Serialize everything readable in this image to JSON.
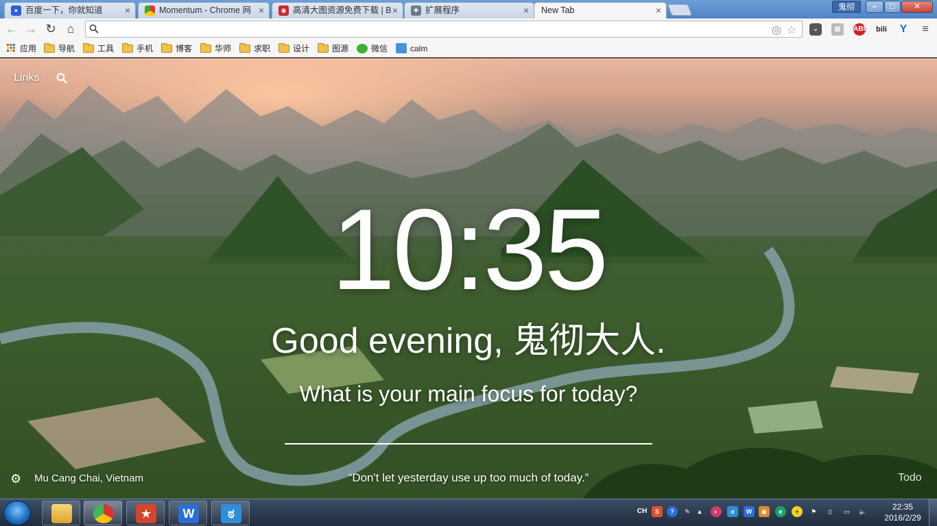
{
  "tabs": [
    {
      "title": "百度一下，你就知道",
      "favicon": "baidu-paw-icon",
      "active": false
    },
    {
      "title": "Momentum - Chrome 网",
      "favicon": "chrome-webstore-icon",
      "active": false
    },
    {
      "title": "高清大图资源免费下载 | B",
      "favicon": "image-site-icon",
      "active": false
    },
    {
      "title": "扩展程序",
      "favicon": "puzzle-piece-icon",
      "active": false
    },
    {
      "title": "New Tab",
      "favicon": "",
      "active": true
    }
  ],
  "window": {
    "user_name": "鬼彻",
    "minimize": "–",
    "maximize": "□",
    "close": "✕"
  },
  "toolbar": {
    "address_value": "",
    "extensions": [
      "pocket-icon",
      "tabs-manager-icon",
      "adblock-plus-icon",
      "bilibili-icon",
      "vpn-icon"
    ],
    "abp_label": "ABP",
    "bili_label": "bili",
    "menu_icon": "hamburger-menu-icon"
  },
  "bookmarks": [
    {
      "label": "应用",
      "type": "apps"
    },
    {
      "label": "导航",
      "type": "folder"
    },
    {
      "label": "工具",
      "type": "folder"
    },
    {
      "label": "手机",
      "type": "folder"
    },
    {
      "label": "博客",
      "type": "folder"
    },
    {
      "label": "华师",
      "type": "folder"
    },
    {
      "label": "求职",
      "type": "folder"
    },
    {
      "label": "设计",
      "type": "folder"
    },
    {
      "label": "图源",
      "type": "folder"
    },
    {
      "label": "微信",
      "type": "wechat"
    },
    {
      "label": "calm",
      "type": "calm"
    }
  ],
  "momentum": {
    "links_label": "Links",
    "time": "10:35",
    "greeting": "Good evening, 鬼彻大人.",
    "focus_prompt": "What is your main focus for today?",
    "focus_value": "",
    "location": "Mu Cang Chai, Vietnam",
    "quote": "“Don't let yesterday use up too much of today.”",
    "todo_label": "Todo"
  },
  "taskbar": {
    "apps": [
      "file-explorer-icon",
      "chrome-icon",
      "wps-presentation-icon",
      "wps-writer-icon",
      "qq-browser-icon"
    ],
    "ime": "CH",
    "time": "22:35",
    "date": "2016/2/29"
  },
  "colors": {
    "tabstrip": "#5b8fd0",
    "chrome_bg": "#f6f6f6",
    "taskbar": "#2a3a50"
  }
}
